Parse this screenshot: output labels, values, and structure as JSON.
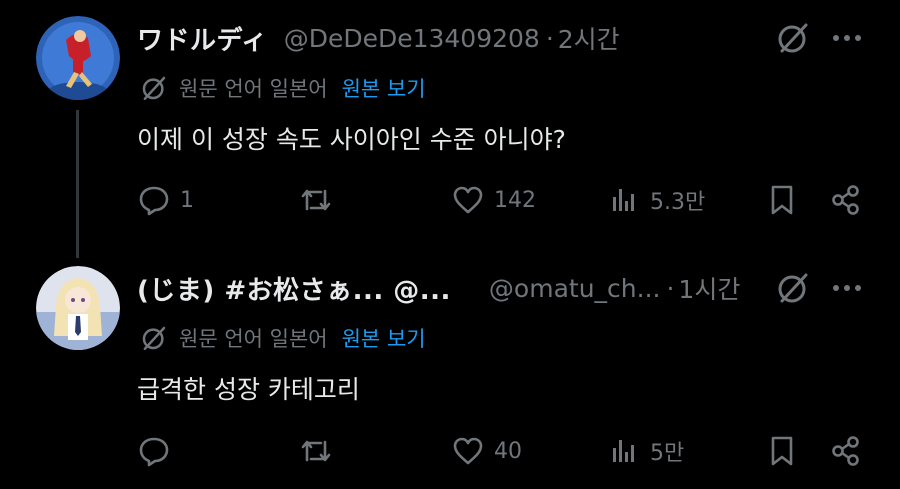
{
  "posts": [
    {
      "display_name": "ワドルディ",
      "handle": "@DeDeDe13409208",
      "separator": "·",
      "time": "2시간",
      "translate": {
        "source_text": "원문 언어 일본어",
        "link_label": "원본 보기"
      },
      "text": "이제 이 성장 속도 사이아인 수준 아니야?",
      "reply_count": "1",
      "repost_count": "",
      "like_count": "142",
      "view_count": "5.3만"
    },
    {
      "display_name": "(じま) #お松さぁ... @...",
      "handle": "@omatu_ch...",
      "separator": "·",
      "time": "1시간",
      "translate": {
        "source_text": "원문 언어 일본어",
        "link_label": "원본 보기"
      },
      "text": "급격한 성장 카테고리",
      "reply_count": "",
      "repost_count": "",
      "like_count": "40",
      "view_count": "5만"
    }
  ],
  "colors": {
    "background": "#000000",
    "text": "#e7e9ea",
    "muted": "#71767b",
    "link": "#1d9bf0"
  },
  "icons": [
    "grok-icon",
    "more-icon",
    "translate-icon",
    "reply-icon",
    "repost-icon",
    "like-icon",
    "views-icon",
    "bookmark-icon",
    "share-icon"
  ]
}
